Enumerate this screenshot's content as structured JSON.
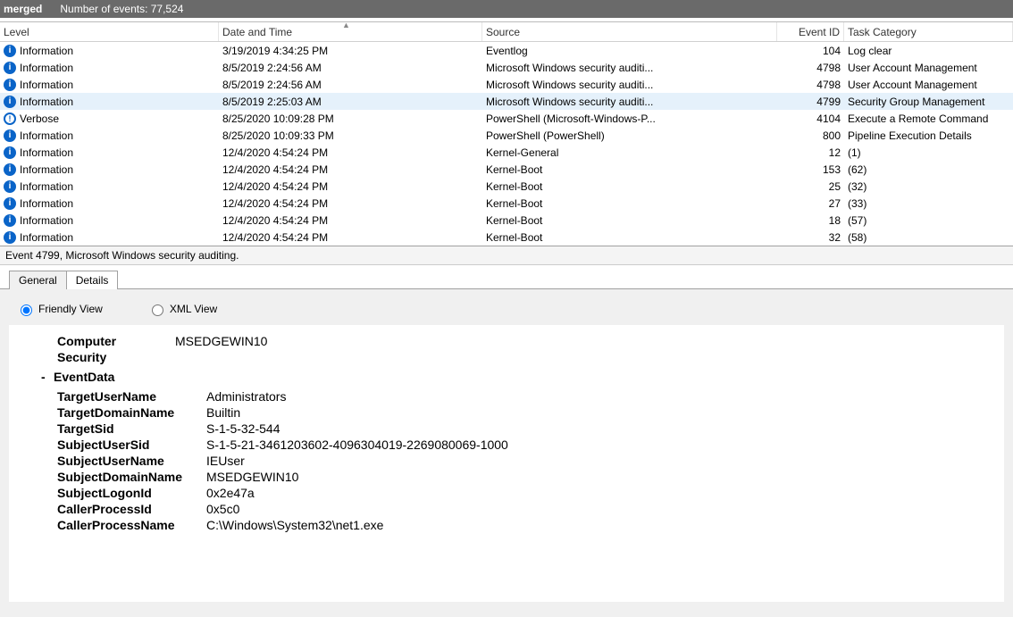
{
  "titlebar": {
    "filename": "merged",
    "events_label": "Number of events: 77,524"
  },
  "columns": {
    "level": "Level",
    "date": "Date and Time",
    "source": "Source",
    "eventid": "Event ID",
    "task": "Task Category"
  },
  "rows": [
    {
      "level": "Information",
      "icon": "info",
      "date": "3/19/2019 4:34:25 PM",
      "source": "Eventlog",
      "eventid": "104",
      "task": "Log clear",
      "selected": false
    },
    {
      "level": "Information",
      "icon": "info",
      "date": "8/5/2019 2:24:56 AM",
      "source": "Microsoft Windows security auditi...",
      "eventid": "4798",
      "task": "User Account Management",
      "selected": false
    },
    {
      "level": "Information",
      "icon": "info",
      "date": "8/5/2019 2:24:56 AM",
      "source": "Microsoft Windows security auditi...",
      "eventid": "4798",
      "task": "User Account Management",
      "selected": false
    },
    {
      "level": "Information",
      "icon": "info",
      "date": "8/5/2019 2:25:03 AM",
      "source": "Microsoft Windows security auditi...",
      "eventid": "4799",
      "task": "Security Group Management",
      "selected": true
    },
    {
      "level": "Verbose",
      "icon": "verbose",
      "date": "8/25/2020 10:09:28 PM",
      "source": "PowerShell (Microsoft-Windows-P...",
      "eventid": "4104",
      "task": "Execute a Remote Command",
      "selected": false
    },
    {
      "level": "Information",
      "icon": "info",
      "date": "8/25/2020 10:09:33 PM",
      "source": "PowerShell (PowerShell)",
      "eventid": "800",
      "task": "Pipeline Execution Details",
      "selected": false
    },
    {
      "level": "Information",
      "icon": "info",
      "date": "12/4/2020 4:54:24 PM",
      "source": "Kernel-General",
      "eventid": "12",
      "task": "(1)",
      "selected": false
    },
    {
      "level": "Information",
      "icon": "info",
      "date": "12/4/2020 4:54:24 PM",
      "source": "Kernel-Boot",
      "eventid": "153",
      "task": "(62)",
      "selected": false
    },
    {
      "level": "Information",
      "icon": "info",
      "date": "12/4/2020 4:54:24 PM",
      "source": "Kernel-Boot",
      "eventid": "25",
      "task": "(32)",
      "selected": false
    },
    {
      "level": "Information",
      "icon": "info",
      "date": "12/4/2020 4:54:24 PM",
      "source": "Kernel-Boot",
      "eventid": "27",
      "task": "(33)",
      "selected": false
    },
    {
      "level": "Information",
      "icon": "info",
      "date": "12/4/2020 4:54:24 PM",
      "source": "Kernel-Boot",
      "eventid": "18",
      "task": "(57)",
      "selected": false
    },
    {
      "level": "Information",
      "icon": "info",
      "date": "12/4/2020 4:54:24 PM",
      "source": "Kernel-Boot",
      "eventid": "32",
      "task": "(58)",
      "selected": false
    }
  ],
  "details": {
    "summary": "Event 4799, Microsoft Windows security auditing.",
    "tabs": {
      "general": "General",
      "details": "Details"
    },
    "views": {
      "friendly": "Friendly View",
      "xml": "XML View"
    },
    "header": {
      "computer_label": "Computer",
      "computer_value": "MSEDGEWIN10",
      "security_label": "Security",
      "eventdata_label": "EventData"
    },
    "eventdata": [
      {
        "k": "TargetUserName",
        "v": "Administrators"
      },
      {
        "k": "TargetDomainName",
        "v": "Builtin"
      },
      {
        "k": "TargetSid",
        "v": "S-1-5-32-544"
      },
      {
        "k": "SubjectUserSid",
        "v": "S-1-5-21-3461203602-4096304019-2269080069-1000"
      },
      {
        "k": "SubjectUserName",
        "v": "IEUser"
      },
      {
        "k": "SubjectDomainName",
        "v": "MSEDGEWIN10"
      },
      {
        "k": "SubjectLogonId",
        "v": "0x2e47a"
      },
      {
        "k": "CallerProcessId",
        "v": "0x5c0"
      },
      {
        "k": "CallerProcessName",
        "v": "C:\\Windows\\System32\\net1.exe"
      }
    ]
  }
}
